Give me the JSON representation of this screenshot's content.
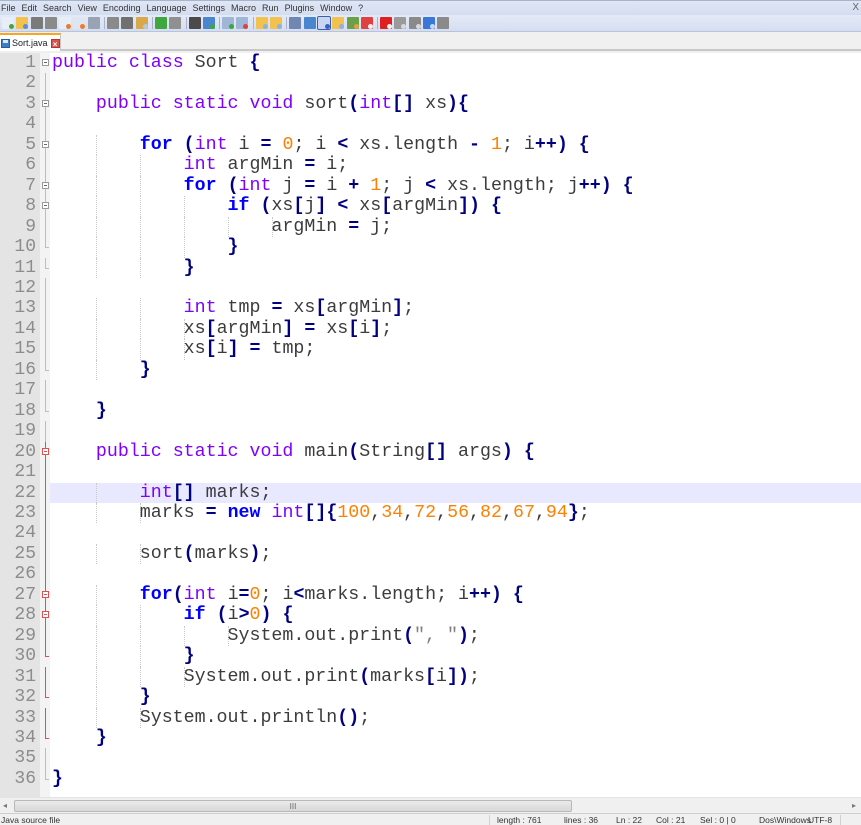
{
  "window": {
    "close_label": "X"
  },
  "menu": [
    "File",
    "Edit",
    "Search",
    "View",
    "Encoding",
    "Language",
    "Settings",
    "Macro",
    "Run",
    "Plugins",
    "Window",
    "?"
  ],
  "toolbar": {
    "buttons": [
      {
        "name": "new-file-icon",
        "color": "#e8eef8",
        "accent": "#3ea83e"
      },
      {
        "name": "open-file-icon",
        "color": "#f2c14e",
        "accent": "#5a8fd8"
      },
      {
        "name": "save-icon",
        "color": "#7a7a7a",
        "accent": "#7a7a7a"
      },
      {
        "name": "save-all-icon",
        "color": "#8a8a8a",
        "accent": "#8a8a8a"
      },
      {
        "name": "close-file-icon",
        "color": "#e8eef8",
        "accent": "#f07a2a"
      },
      {
        "name": "close-all-icon",
        "color": "#dfe6f1",
        "accent": "#f07a2a"
      },
      {
        "name": "print-icon",
        "color": "#9aa3b3",
        "accent": "#9aa3b3"
      },
      {
        "sep": true
      },
      {
        "name": "cut-icon",
        "color": "#8a8a8a",
        "accent": "#8a8a8a"
      },
      {
        "name": "copy-icon",
        "color": "#707070",
        "accent": "#707070"
      },
      {
        "name": "paste-icon",
        "color": "#d8a84a",
        "accent": "#b9c7dd"
      },
      {
        "sep": true
      },
      {
        "name": "undo-icon",
        "color": "#3ea83e",
        "accent": "#3ea83e"
      },
      {
        "name": "redo-icon",
        "color": "#909090",
        "accent": "#909090"
      },
      {
        "sep": true
      },
      {
        "name": "find-icon",
        "color": "#4a4a4a",
        "accent": "#4a4a4a"
      },
      {
        "name": "replace-icon",
        "color": "#4a86d0",
        "accent": "#3ea83e"
      },
      {
        "sep": true
      },
      {
        "name": "zoom-in-icon",
        "color": "#9fb6d6",
        "accent": "#3ea83e"
      },
      {
        "name": "zoom-out-icon",
        "color": "#9fb6d6",
        "accent": "#e04040"
      },
      {
        "sep": true
      },
      {
        "name": "sync-vertical-icon",
        "color": "#f2c14e",
        "accent": "#8fb2e0"
      },
      {
        "name": "sync-horizontal-icon",
        "color": "#f2c14e",
        "accent": "#8fb2e0"
      },
      {
        "sep": true
      },
      {
        "name": "word-wrap-icon",
        "color": "#6f87b3",
        "accent": "#6f87b3"
      },
      {
        "name": "show-all-chars-icon",
        "color": "#4a86d0",
        "accent": "#4a86d0"
      },
      {
        "name": "indent-guide-icon",
        "color": "#3b5fc9",
        "accent": "#c9d6f0",
        "active": true
      },
      {
        "name": "user-language-icon",
        "color": "#f2c14e",
        "accent": "#8fb2e0"
      },
      {
        "name": "document-map-icon",
        "color": "#6ba04a",
        "accent": "#e0a040"
      },
      {
        "name": "function-list-icon",
        "color": "#e04040",
        "accent": "#f0f0f0"
      },
      {
        "sep": true
      },
      {
        "name": "record-macro-icon",
        "color": "#e02020",
        "accent": "#f4f4f4"
      },
      {
        "name": "stop-recording-icon",
        "color": "#9a9a9a",
        "accent": "#d8d8d8"
      },
      {
        "name": "play-macro-icon",
        "color": "#8a8a8a",
        "accent": "#d8d8d8"
      },
      {
        "name": "run-macro-multiple-icon",
        "color": "#3a78d8",
        "accent": "#c9d6f0"
      },
      {
        "name": "save-macro-icon",
        "color": "#8a8a8a",
        "accent": "#8a8a8a"
      }
    ]
  },
  "tabs": [
    {
      "label": "Sort.java",
      "active": true,
      "close_label": "×"
    }
  ],
  "editor": {
    "current_line": 22,
    "lines": [
      {
        "n": "1",
        "fold": "open",
        "tokens": [
          [
            "ty",
            "public"
          ],
          [
            "txt",
            " "
          ],
          [
            "ty",
            "class"
          ],
          [
            "txt",
            " Sort "
          ],
          [
            "op",
            "{"
          ]
        ]
      },
      {
        "n": "2",
        "fold": "line",
        "tokens": []
      },
      {
        "n": "3",
        "fold": "open",
        "tokens": [
          [
            "txt",
            "    "
          ],
          [
            "ty",
            "public"
          ],
          [
            "txt",
            " "
          ],
          [
            "ty",
            "static"
          ],
          [
            "txt",
            " "
          ],
          [
            "ty",
            "void"
          ],
          [
            "txt",
            " sort"
          ],
          [
            "op",
            "("
          ],
          [
            "ty",
            "int"
          ],
          [
            "op",
            "[]"
          ],
          [
            "txt",
            " xs"
          ],
          [
            "op",
            "){"
          ]
        ]
      },
      {
        "n": "4",
        "fold": "line",
        "tokens": []
      },
      {
        "n": "5",
        "fold": "open",
        "tokens": [
          [
            "txt",
            "        "
          ],
          [
            "kw",
            "for"
          ],
          [
            "txt",
            " "
          ],
          [
            "op",
            "("
          ],
          [
            "ty",
            "int"
          ],
          [
            "txt",
            " i "
          ],
          [
            "op",
            "="
          ],
          [
            "txt",
            " "
          ],
          [
            "num",
            "0"
          ],
          [
            "txt",
            "; i "
          ],
          [
            "op",
            "<"
          ],
          [
            "txt",
            " xs.length "
          ],
          [
            "op",
            "-"
          ],
          [
            "txt",
            " "
          ],
          [
            "num",
            "1"
          ],
          [
            "txt",
            "; i"
          ],
          [
            "op",
            "++)"
          ],
          [
            "txt",
            " "
          ],
          [
            "op",
            "{"
          ]
        ]
      },
      {
        "n": "6",
        "fold": "line",
        "tokens": [
          [
            "txt",
            "            "
          ],
          [
            "ty",
            "int"
          ],
          [
            "txt",
            " argMin "
          ],
          [
            "op",
            "="
          ],
          [
            "txt",
            " i;"
          ]
        ]
      },
      {
        "n": "7",
        "fold": "open",
        "tokens": [
          [
            "txt",
            "            "
          ],
          [
            "kw",
            "for"
          ],
          [
            "txt",
            " "
          ],
          [
            "op",
            "("
          ],
          [
            "ty",
            "int"
          ],
          [
            "txt",
            " j "
          ],
          [
            "op",
            "="
          ],
          [
            "txt",
            " i "
          ],
          [
            "op",
            "+"
          ],
          [
            "txt",
            " "
          ],
          [
            "num",
            "1"
          ],
          [
            "txt",
            "; j "
          ],
          [
            "op",
            "<"
          ],
          [
            "txt",
            " xs.length; j"
          ],
          [
            "op",
            "++)"
          ],
          [
            "txt",
            " "
          ],
          [
            "op",
            "{"
          ]
        ]
      },
      {
        "n": "8",
        "fold": "open",
        "tokens": [
          [
            "txt",
            "                "
          ],
          [
            "kw",
            "if"
          ],
          [
            "txt",
            " "
          ],
          [
            "op",
            "("
          ],
          [
            "txt",
            "xs"
          ],
          [
            "op",
            "["
          ],
          [
            "txt",
            "j"
          ],
          [
            "op",
            "]"
          ],
          [
            "txt",
            " "
          ],
          [
            "op",
            "<"
          ],
          [
            "txt",
            " xs"
          ],
          [
            "op",
            "["
          ],
          [
            "txt",
            "argMin"
          ],
          [
            "op",
            "])"
          ],
          [
            "txt",
            " "
          ],
          [
            "op",
            "{"
          ]
        ]
      },
      {
        "n": "9",
        "fold": "line",
        "tokens": [
          [
            "txt",
            "                    argMin "
          ],
          [
            "op",
            "="
          ],
          [
            "txt",
            " j;"
          ]
        ]
      },
      {
        "n": "10",
        "fold": "end",
        "tokens": [
          [
            "txt",
            "                "
          ],
          [
            "op",
            "}"
          ]
        ]
      },
      {
        "n": "11",
        "fold": "end",
        "tokens": [
          [
            "txt",
            "            "
          ],
          [
            "op",
            "}"
          ]
        ]
      },
      {
        "n": "12",
        "fold": "line",
        "tokens": []
      },
      {
        "n": "13",
        "fold": "line",
        "tokens": [
          [
            "txt",
            "            "
          ],
          [
            "ty",
            "int"
          ],
          [
            "txt",
            " tmp "
          ],
          [
            "op",
            "="
          ],
          [
            "txt",
            " xs"
          ],
          [
            "op",
            "["
          ],
          [
            "txt",
            "argMin"
          ],
          [
            "op",
            "]"
          ],
          [
            "txt",
            ";"
          ]
        ]
      },
      {
        "n": "14",
        "fold": "line",
        "tokens": [
          [
            "txt",
            "            xs"
          ],
          [
            "op",
            "["
          ],
          [
            "txt",
            "argMin"
          ],
          [
            "op",
            "]"
          ],
          [
            "txt",
            " "
          ],
          [
            "op",
            "="
          ],
          [
            "txt",
            " xs"
          ],
          [
            "op",
            "["
          ],
          [
            "txt",
            "i"
          ],
          [
            "op",
            "]"
          ],
          [
            "txt",
            ";"
          ]
        ]
      },
      {
        "n": "15",
        "fold": "line",
        "tokens": [
          [
            "txt",
            "            xs"
          ],
          [
            "op",
            "["
          ],
          [
            "txt",
            "i"
          ],
          [
            "op",
            "]"
          ],
          [
            "txt",
            " "
          ],
          [
            "op",
            "="
          ],
          [
            "txt",
            " tmp;"
          ]
        ]
      },
      {
        "n": "16",
        "fold": "end",
        "tokens": [
          [
            "txt",
            "        "
          ],
          [
            "op",
            "}"
          ]
        ]
      },
      {
        "n": "17",
        "fold": "line",
        "tokens": []
      },
      {
        "n": "18",
        "fold": "end",
        "tokens": [
          [
            "txt",
            "    "
          ],
          [
            "op",
            "}"
          ]
        ]
      },
      {
        "n": "19",
        "fold": "line",
        "tokens": []
      },
      {
        "n": "20",
        "fold": "open-red",
        "tokens": [
          [
            "txt",
            "    "
          ],
          [
            "ty",
            "public"
          ],
          [
            "txt",
            " "
          ],
          [
            "ty",
            "static"
          ],
          [
            "txt",
            " "
          ],
          [
            "ty",
            "void"
          ],
          [
            "txt",
            " main"
          ],
          [
            "op",
            "("
          ],
          [
            "txt",
            "String"
          ],
          [
            "op",
            "[]"
          ],
          [
            "txt",
            " args"
          ],
          [
            "op",
            ")"
          ],
          [
            "txt",
            " "
          ],
          [
            "op",
            "{"
          ]
        ]
      },
      {
        "n": "21",
        "fold": "line-red",
        "tokens": []
      },
      {
        "n": "22",
        "fold": "line-red",
        "tokens": [
          [
            "txt",
            "        "
          ],
          [
            "ty",
            "int"
          ],
          [
            "op",
            "[]"
          ],
          [
            "txt",
            " marks;"
          ]
        ]
      },
      {
        "n": "23",
        "fold": "line-red",
        "tokens": [
          [
            "txt",
            "        marks "
          ],
          [
            "op",
            "="
          ],
          [
            "txt",
            " "
          ],
          [
            "kw",
            "new"
          ],
          [
            "txt",
            " "
          ],
          [
            "ty",
            "int"
          ],
          [
            "op",
            "[]{"
          ],
          [
            "num",
            "100"
          ],
          [
            "txt",
            ","
          ],
          [
            "num",
            "34"
          ],
          [
            "txt",
            ","
          ],
          [
            "num",
            "72"
          ],
          [
            "txt",
            ","
          ],
          [
            "num",
            "56"
          ],
          [
            "txt",
            ","
          ],
          [
            "num",
            "82"
          ],
          [
            "txt",
            ","
          ],
          [
            "num",
            "67"
          ],
          [
            "txt",
            ","
          ],
          [
            "num",
            "94"
          ],
          [
            "op",
            "}"
          ],
          [
            "txt",
            ";"
          ]
        ]
      },
      {
        "n": "24",
        "fold": "line-red",
        "tokens": []
      },
      {
        "n": "25",
        "fold": "line-red",
        "tokens": [
          [
            "txt",
            "        sort"
          ],
          [
            "op",
            "("
          ],
          [
            "txt",
            "marks"
          ],
          [
            "op",
            ")"
          ],
          [
            "txt",
            ";"
          ]
        ]
      },
      {
        "n": "26",
        "fold": "line-red",
        "tokens": []
      },
      {
        "n": "27",
        "fold": "open-red",
        "tokens": [
          [
            "txt",
            "        "
          ],
          [
            "kw",
            "for"
          ],
          [
            "op",
            "("
          ],
          [
            "ty",
            "int"
          ],
          [
            "txt",
            " i"
          ],
          [
            "op",
            "="
          ],
          [
            "num",
            "0"
          ],
          [
            "txt",
            "; i"
          ],
          [
            "op",
            "<"
          ],
          [
            "txt",
            "marks.length; i"
          ],
          [
            "op",
            "++)"
          ],
          [
            "txt",
            " "
          ],
          [
            "op",
            "{"
          ]
        ]
      },
      {
        "n": "28",
        "fold": "open-red",
        "tokens": [
          [
            "txt",
            "            "
          ],
          [
            "kw",
            "if"
          ],
          [
            "txt",
            " "
          ],
          [
            "op",
            "("
          ],
          [
            "txt",
            "i"
          ],
          [
            "op",
            ">"
          ],
          [
            "num",
            "0"
          ],
          [
            "op",
            ")"
          ],
          [
            "txt",
            " "
          ],
          [
            "op",
            "{"
          ]
        ]
      },
      {
        "n": "29",
        "fold": "line-red",
        "tokens": [
          [
            "txt",
            "                System.out.print"
          ],
          [
            "op",
            "("
          ],
          [
            "str",
            "\", \""
          ],
          [
            "op",
            ")"
          ],
          [
            "txt",
            ";"
          ]
        ]
      },
      {
        "n": "30",
        "fold": "end-red",
        "tokens": [
          [
            "txt",
            "            "
          ],
          [
            "op",
            "}"
          ]
        ]
      },
      {
        "n": "31",
        "fold": "line-red",
        "tokens": [
          [
            "txt",
            "            System.out.print"
          ],
          [
            "op",
            "("
          ],
          [
            "txt",
            "marks"
          ],
          [
            "op",
            "["
          ],
          [
            "txt",
            "i"
          ],
          [
            "op",
            "])"
          ],
          [
            "txt",
            ";"
          ]
        ]
      },
      {
        "n": "32",
        "fold": "end-red",
        "tokens": [
          [
            "txt",
            "        "
          ],
          [
            "op",
            "}"
          ]
        ]
      },
      {
        "n": "33",
        "fold": "line-red",
        "tokens": [
          [
            "txt",
            "        System.out.println"
          ],
          [
            "op",
            "()"
          ],
          [
            "txt",
            ";"
          ]
        ]
      },
      {
        "n": "34",
        "fold": "end-red",
        "tokens": [
          [
            "txt",
            "    "
          ],
          [
            "op",
            "}"
          ]
        ]
      },
      {
        "n": "35",
        "fold": "line",
        "tokens": []
      },
      {
        "n": "36",
        "fold": "end",
        "tokens": [
          [
            "op",
            "}"
          ]
        ]
      }
    ]
  },
  "scrollbar": {
    "grip": "III",
    "left_arrow": "◂",
    "right_arrow": "▸",
    "visible_fraction": 0.67
  },
  "status": {
    "file_type": "Java source file",
    "length": "length : 761",
    "lines": "lines : 36",
    "ln": "Ln : 22",
    "col": "Col : 21",
    "sel": "Sel : 0 | 0",
    "eol": "Dos\\Windows",
    "encoding": "UTF-8"
  }
}
